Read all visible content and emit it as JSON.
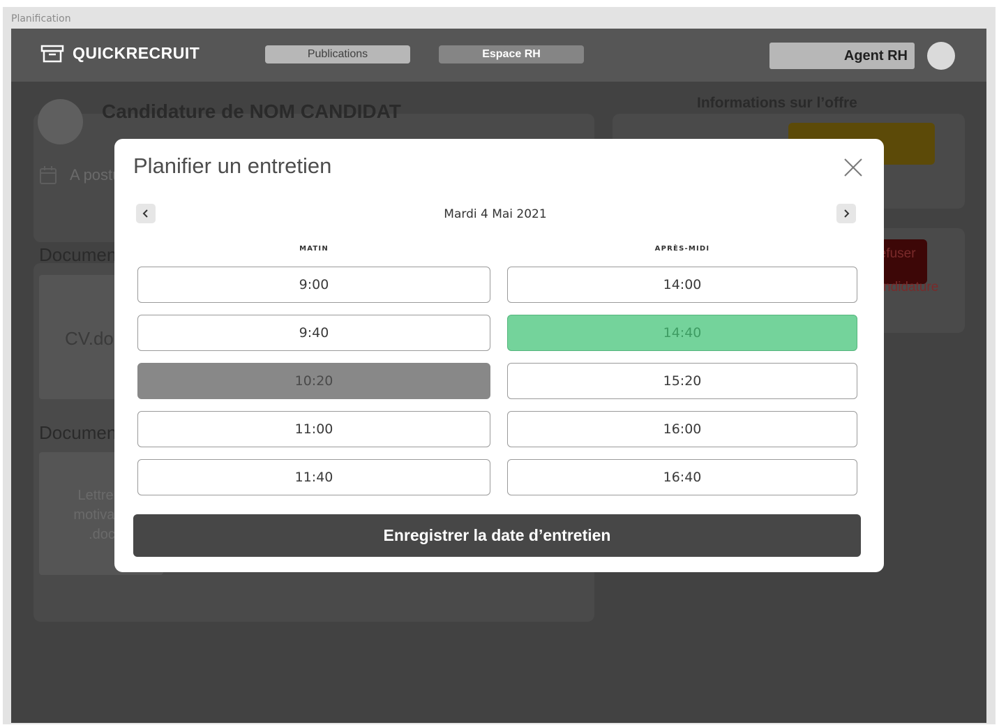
{
  "frame": {
    "label": "Planification"
  },
  "navbar": {
    "logo_text": "QUICKRECRUIT",
    "logo_icon": "archive-box-icon",
    "publications_label": "Publications",
    "espace_rh_label": "Espace RH",
    "user_label": "Agent RH"
  },
  "background": {
    "candidature_title": "Candidature de NOM CANDIDAT",
    "apostule_text": "A postulé",
    "documents_title_1": "Documents",
    "cv_label": "CV.docx",
    "documents_title_2": "Documents",
    "lettre_label": "Lettre de motivation .docx",
    "offer_title": "Informations sur l’offre",
    "red_button_label": "Refuser la candidature"
  },
  "modal": {
    "title": "Planifier un entretien",
    "date_label": "Mardi 4 Mai 2021",
    "morning_label": "MATIN",
    "afternoon_label": "APRÈS-MIDI",
    "morning_slots": [
      {
        "time": "9:00",
        "state": "available"
      },
      {
        "time": "9:40",
        "state": "available"
      },
      {
        "time": "10:20",
        "state": "disabled"
      },
      {
        "time": "11:00",
        "state": "available"
      },
      {
        "time": "11:40",
        "state": "available"
      }
    ],
    "afternoon_slots": [
      {
        "time": "14:00",
        "state": "available"
      },
      {
        "time": "14:40",
        "state": "selected"
      },
      {
        "time": "15:20",
        "state": "available"
      },
      {
        "time": "16:00",
        "state": "available"
      },
      {
        "time": "16:40",
        "state": "available"
      }
    ],
    "save_label": "Enregistrer la date d’entretien"
  },
  "colors": {
    "overlay": "#424242",
    "navbar": "#565656",
    "selected_slot": "#74d39b",
    "disabled_slot": "#888888",
    "save_button": "#474747"
  }
}
